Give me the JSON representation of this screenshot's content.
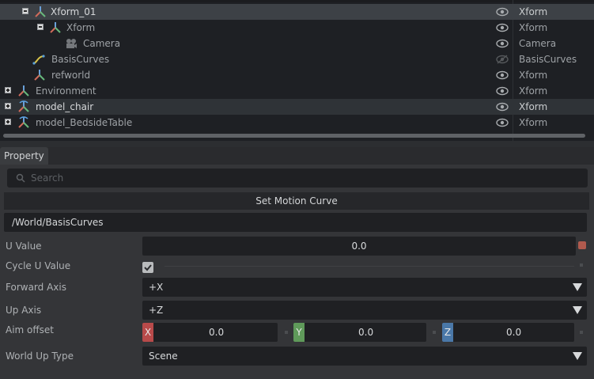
{
  "stage": {
    "rows": [
      {
        "name": "Xform_01",
        "type": "Xform"
      },
      {
        "name": "Xform",
        "type": "Xform"
      },
      {
        "name": "Camera",
        "type": "Camera"
      },
      {
        "name": "BasisCurves",
        "type": "BasisCurves"
      },
      {
        "name": "refworld",
        "type": "Xform"
      },
      {
        "name": "Environment",
        "type": "Xform"
      },
      {
        "name": "model_chair",
        "type": "Xform"
      },
      {
        "name": "model_BedsideTable",
        "type": "Xform"
      }
    ]
  },
  "property": {
    "tab_label": "Property",
    "search_placeholder": "Search",
    "section_title": "Set Motion Curve",
    "prim_path": "/World/BasisCurves",
    "u_value_label": "U Value",
    "u_value": "0.0",
    "cycle_label": "Cycle U Value",
    "cycle_checked": true,
    "forward_axis_label": "Forward Axis",
    "forward_axis_value": "+X",
    "up_axis_label": "Up Axis",
    "up_axis_value": "+Z",
    "aim_offset_label": "Aim offset",
    "aim_x_tag": "X",
    "aim_x": "0.0",
    "aim_y_tag": "Y",
    "aim_y": "0.0",
    "aim_z_tag": "Z",
    "aim_z": "0.0",
    "world_up_label": "World Up Type",
    "world_up_value": "Scene"
  },
  "colors": {
    "axis_x": "#b84a4a",
    "axis_y": "#5f9a5a",
    "axis_z": "#4a78a8",
    "curve_icon": "#d7c34a"
  }
}
